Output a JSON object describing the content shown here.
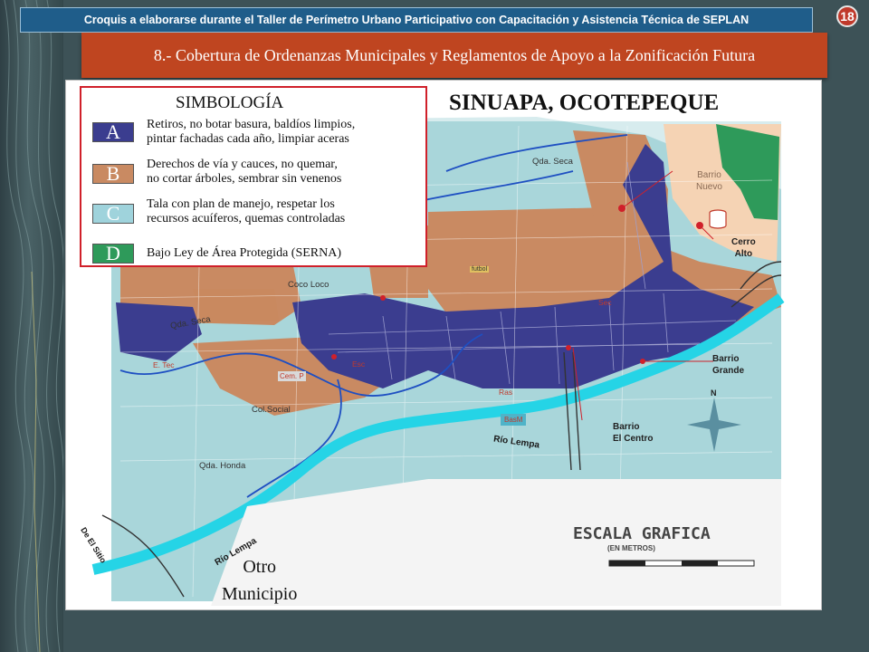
{
  "header": {
    "banner": "Croquis a elaborarse durante el Taller de Perímetro Urbano Participativo con Capacitación y Asistencia Técnica de SEPLAN",
    "page_number": "18",
    "section_title": "8.- Cobertura de Ordenanzas Municipales y Reglamentos de Apoyo a la Zonificación Futura"
  },
  "map": {
    "title": "SINUAPA, OCOTEPEQUE",
    "legend": {
      "title": "SIMBOLOGÍA",
      "items": [
        {
          "key": "A",
          "color": "#3b3d8f",
          "line1": "Retiros, no botar basura, baldíos limpios,",
          "line2": "pintar fachadas cada año, limpiar aceras"
        },
        {
          "key": "B",
          "color": "#c98a62",
          "line1": "Derechos de vía y cauces, no quemar,",
          "line2": "no cortar árboles, sembrar sin venenos"
        },
        {
          "key": "C",
          "color": "#9fd3dc",
          "line1": "Tala con plan de manejo, respetar los",
          "line2": "recursos acuíferos, quemas controladas"
        },
        {
          "key": "D",
          "color": "#2e9a5a",
          "line1": "Bajo Ley de Área Protegida (SERNA)",
          "line2": ""
        }
      ]
    },
    "labels": {
      "qda_seca_top": "Qda. Seca",
      "qda_seca_left": "Qda. Seca",
      "coco_loco": "Coco Loco",
      "col_social": "Col.Social",
      "qda_honda": "Qda. Honda",
      "rio_lempa_center": "Río Lempa",
      "rio_lempa_bottom": "Río Lempa",
      "de_el_sitio": "De El Sitio",
      "barrio_nuevo": "Barrio\nNuevo",
      "cerro_alto": "Cerro\nAlto",
      "barrio_grande": "Barrio\nGrande",
      "barrio_el_centro": "Barrio\nEl Centro",
      "otro_municipio": "Otro\nMunicipio",
      "escala": "ESCALA GRAFICA",
      "escala_sub": "(EN METROS)",
      "north": "N",
      "futbol": "futbol",
      "cem": "Cem. P",
      "bas": "BasM",
      "ras": "Ras",
      "sec": "Sec",
      "e_tec": "E. Tec",
      "esc": "Esc"
    }
  }
}
